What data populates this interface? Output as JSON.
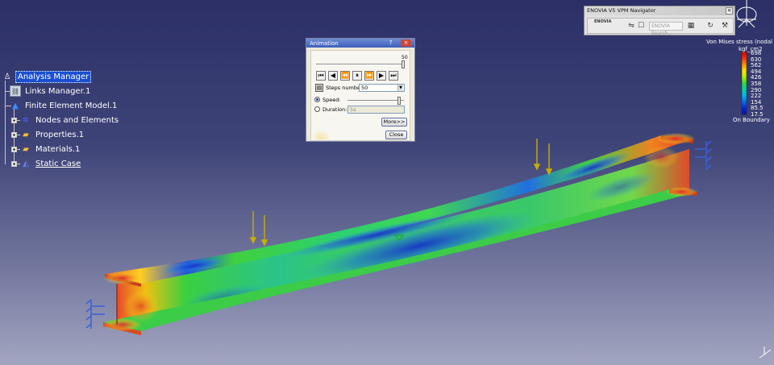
{
  "tree": {
    "root": "Analysis Manager",
    "items": [
      {
        "label": "Links Manager.1",
        "icon": "links-manager-icon"
      },
      {
        "label": "Finite Element Model.1",
        "icon": "fem-icon"
      },
      {
        "label": "Nodes and Elements",
        "icon": "mesh-nodes-icon"
      },
      {
        "label": "Properties.1",
        "icon": "folder-icon"
      },
      {
        "label": "Materials.1",
        "icon": "folder-icon"
      },
      {
        "label": "Static Case",
        "icon": "static-case-icon"
      }
    ]
  },
  "animation": {
    "title": "Animation",
    "help": "?",
    "close_x": "×",
    "frame_value": "50",
    "frame_fraction": 1.0,
    "buttons": [
      "⏮",
      "◀",
      "⏪",
      "⏸",
      "⏩",
      "▶",
      "⏭"
    ],
    "steps_label": "Steps number",
    "steps_value": "50",
    "speed_label": "Speed:",
    "speed_fraction": 0.92,
    "duration_label": "Duration:",
    "duration_value": "5s",
    "more_label": "More>>",
    "close_label": "Close"
  },
  "enovia": {
    "title": "ENOVIA V5 VPM Navigator",
    "logo": "ENOVIA",
    "search_placeholder": "ENOVIA Search...",
    "close": "×"
  },
  "legend": {
    "title": "Von Mises stress (nodal v",
    "unit": "kgf_cm2",
    "values": [
      "698",
      "630",
      "562",
      "494",
      "426",
      "358",
      "290",
      "222",
      "154",
      "85.5",
      "17.5"
    ],
    "footer": "On Boundary",
    "colors": [
      "#c80000",
      "#ff2a00",
      "#ff8c00",
      "#ffe000",
      "#b8f000",
      "#30e030",
      "#00d8a0",
      "#00b8e8",
      "#0070f0",
      "#0028d8",
      "#1010a8"
    ]
  },
  "colors": {
    "beam_green": "#4cd04a",
    "stress_blue": "#1a3fd8",
    "stress_red": "#e8402a",
    "load_arrow": "#c8b000",
    "support": "#3b5fd8"
  }
}
